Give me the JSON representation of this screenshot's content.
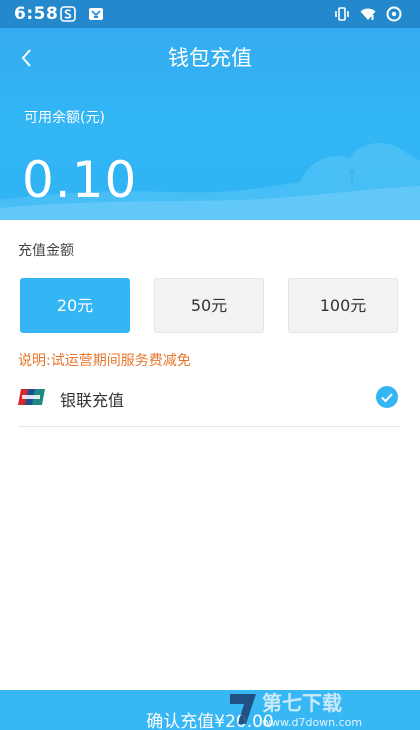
{
  "status_bar": {
    "time": "6:58",
    "left_icons": [
      "sogou-input-icon",
      "app-notification-icon"
    ],
    "right_icons": [
      "vibrate-icon",
      "wifi-icon",
      "sync-icon"
    ]
  },
  "nav": {
    "title": "钱包充值",
    "back_icon": "chevron-left-icon"
  },
  "balance": {
    "label": "可用余额(元)",
    "value": "0.10"
  },
  "amount_section": {
    "label": "充值金额",
    "options": [
      {
        "label": "20元",
        "selected": true
      },
      {
        "label": "50元",
        "selected": false
      },
      {
        "label": "100元",
        "selected": false
      }
    ],
    "note": "说明:试运营期间服务费减免"
  },
  "payment": {
    "method_label": "银联充值",
    "method_icon": "unionpay-logo-icon",
    "selected": true
  },
  "confirm": {
    "label": "确认充值¥20.00"
  },
  "watermark": {
    "brand": "第七下载",
    "url": "www.d7down.com"
  },
  "colors": {
    "primary": "#35b6f4",
    "status_bar": "#2489cc",
    "note": "#e6762b"
  }
}
